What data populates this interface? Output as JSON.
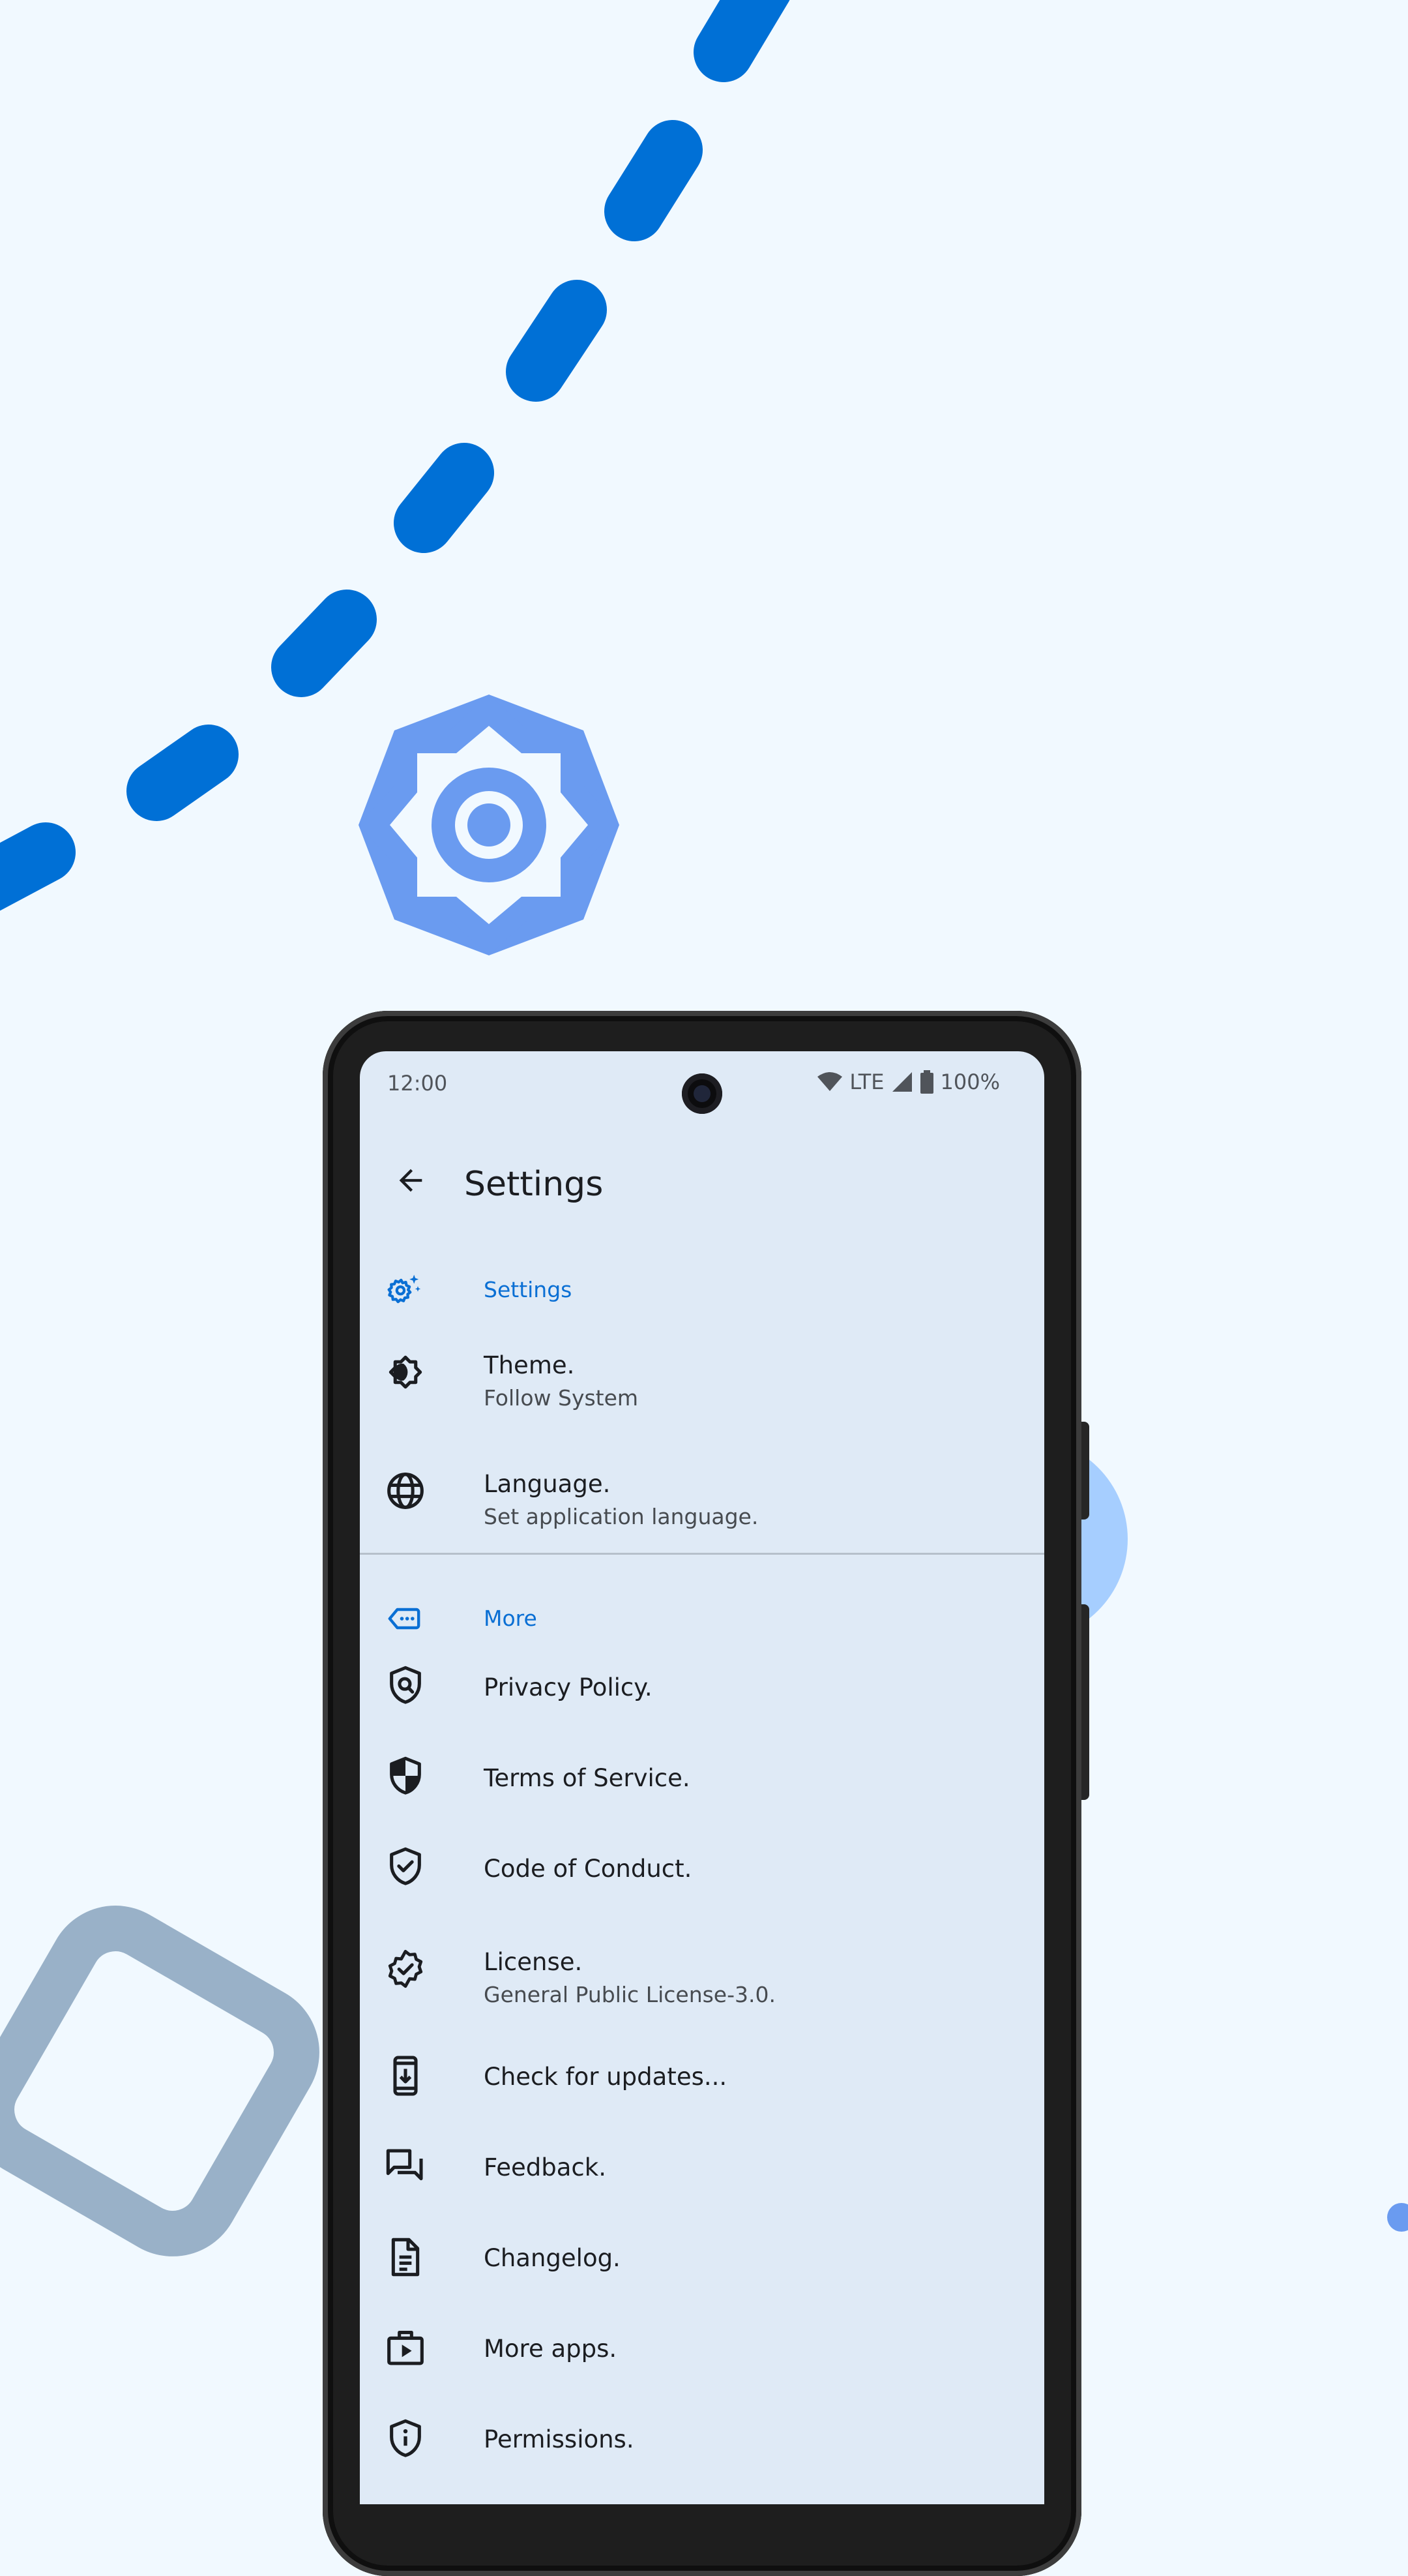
{
  "status_bar": {
    "time": "12:00",
    "network": "LTE",
    "battery": "100%"
  },
  "app_bar": {
    "title": "Settings"
  },
  "sections": [
    {
      "title": "Settings",
      "icon": "settings-sparkle-icon",
      "items": [
        {
          "label": "Theme.",
          "subtitle": "Follow System",
          "icon": "brightness-icon"
        },
        {
          "label": "Language.",
          "subtitle": "Set application language.",
          "icon": "globe-icon"
        }
      ]
    },
    {
      "title": "More",
      "icon": "more-tag-icon",
      "items": [
        {
          "label": "Privacy Policy.",
          "icon": "privacy-shield-icon"
        },
        {
          "label": "Terms of Service.",
          "icon": "half-shield-icon"
        },
        {
          "label": "Code of Conduct.",
          "icon": "check-shield-icon"
        },
        {
          "label": "License.",
          "subtitle": "General Public License-3.0.",
          "icon": "verified-badge-icon"
        },
        {
          "label": "Check for updates...",
          "icon": "phone-download-icon"
        },
        {
          "label": "Feedback.",
          "icon": "chat-bubbles-icon"
        },
        {
          "label": "Changelog.",
          "icon": "document-icon"
        },
        {
          "label": "More apps.",
          "icon": "play-bag-icon"
        },
        {
          "label": "Permissions.",
          "icon": "info-shield-icon"
        }
      ]
    }
  ],
  "colors": {
    "background": "#f1f9ff",
    "screen": "#dfeaf6",
    "accent": "#0a6fd4",
    "dashes": "#0070d6",
    "decor_sun": "#6a9bf0",
    "decor_outline": "#99b1c8",
    "decor_circle": "#a6ceff"
  }
}
